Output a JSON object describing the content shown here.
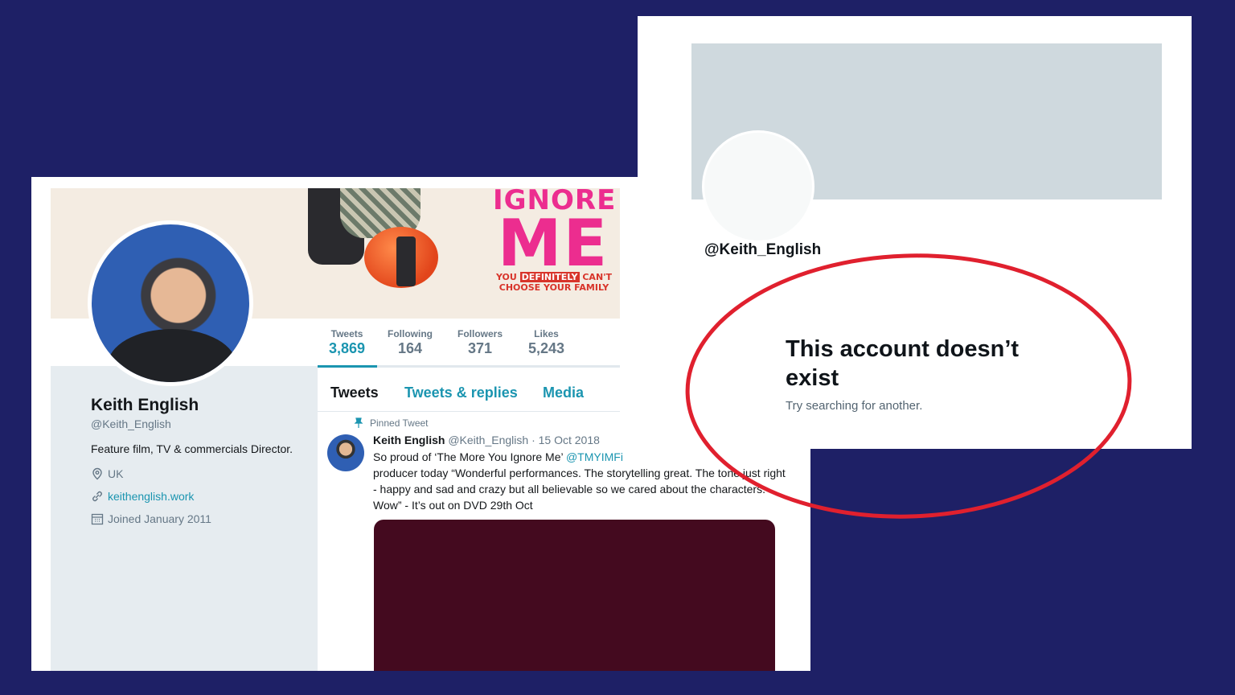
{
  "profile": {
    "banner": {
      "title_line1": "IGNORE",
      "title_line2": "ME",
      "tagline_line1_start": "YOU",
      "tagline_line1_badge": "DEFINITELY",
      "tagline_line1_end": "CAN'T",
      "tagline_line2": "CHOOSE YOUR FAMILY"
    },
    "name": "Keith English",
    "handle": "@Keith_English",
    "bio": "Feature film, TV & commercials Director.",
    "location": "UK",
    "website": "keithenglish.work",
    "joined": "Joined January 2011",
    "stats": [
      {
        "label": "Tweets",
        "value": "3,869"
      },
      {
        "label": "Following",
        "value": "164"
      },
      {
        "label": "Followers",
        "value": "371"
      },
      {
        "label": "Likes",
        "value": "5,243"
      }
    ],
    "tabs": [
      "Tweets",
      "Tweets & replies",
      "Media"
    ],
    "pinned_label": "Pinned Tweet",
    "tweet": {
      "author": "Keith English",
      "handle": "@Keith_English",
      "date": "· 15 Oct 2018",
      "text_part1": "So proud of ‘The More You Ignore Me’ ",
      "mention": "@TMYIMFi",
      "text_part2": "producer today “Wonderful performances. The storytelling great. The tone just right - happy and sad and crazy but all believable so we cared about the characters. Wow” - It’s out on DVD 29th Oct"
    }
  },
  "removed": {
    "handle": "@Keith_English",
    "title": "This account doesn’t exist",
    "subtitle": "Try searching for another."
  },
  "colors": {
    "background": "#1e2066",
    "accent": "#1b95b0",
    "highlight_ring": "#e0202e"
  }
}
